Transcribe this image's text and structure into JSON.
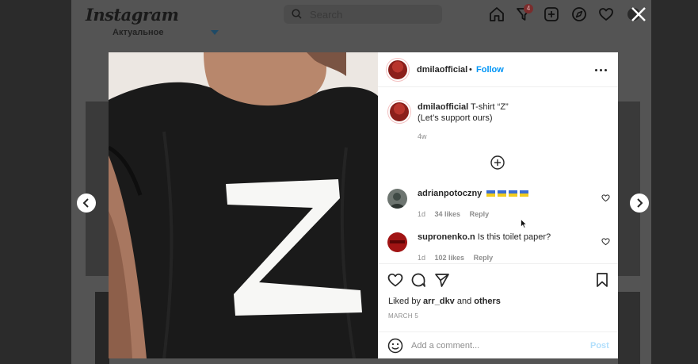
{
  "background": {
    "logo": "Instagram",
    "search_placeholder": "Search",
    "notification_count": "4",
    "story_highlight": "Актуальное",
    "nav_icons": [
      "home-icon",
      "activity-icon",
      "new-post-icon",
      "explore-icon",
      "heart-icon",
      "profile-icon"
    ]
  },
  "post": {
    "author": "dmilaofficial",
    "dot": "•",
    "follow_label": "Follow",
    "caption_line1": "T-shirt “Z”",
    "caption_line2": "(Let’s support ours)",
    "time_ago": "4w",
    "image_letter": "Z",
    "comments": [
      {
        "user": "adrianpotoczny",
        "flags": 4,
        "time": "1d",
        "likes": "34 likes",
        "reply": "Reply"
      },
      {
        "user": "supronenko.n",
        "text": "Is this toilet paper?",
        "time": "1d",
        "likes": "102 likes",
        "reply": "Reply"
      }
    ],
    "liked_by_prefix": "Liked by",
    "liked_by_user": "arr_dkv",
    "liked_by_and": "and",
    "liked_by_others": "others",
    "date": "MARCH 5",
    "comment_placeholder": "Add a comment...",
    "post_label": "Post"
  },
  "colors": {
    "accent": "#0095f6",
    "post_disabled": "#b2dffc",
    "overlay": "#545454"
  }
}
